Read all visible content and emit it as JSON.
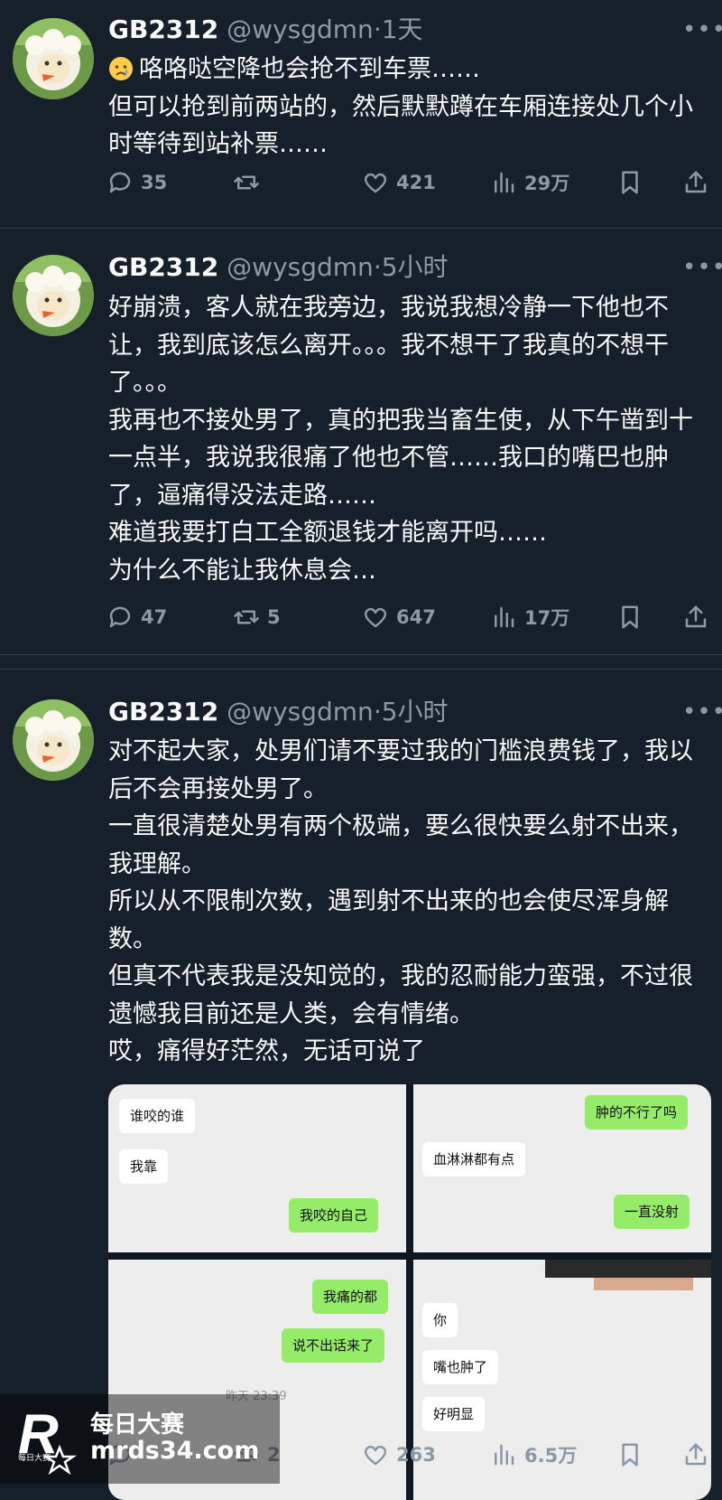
{
  "tweets": [
    {
      "name": "GB2312",
      "handle": "@wysgdmn",
      "dot": "·",
      "time": "1天",
      "emoji": "crying-face",
      "text": "咯咯哒空降也会抢不到车票……\n但可以抢到前两站的，然后默默蹲在车厢连接处几个小时等待到站补票……",
      "stats": {
        "replies": "35",
        "retweets": "",
        "likes": "421",
        "views": "29万"
      }
    },
    {
      "name": "GB2312",
      "handle": "@wysgdmn",
      "dot": "·",
      "time": "5小时",
      "text": "好崩溃，客人就在我旁边，我说我想冷静一下他也不让，我到底该怎么离开。。。我不想干了我真的不想干了。。。\n我再也不接处男了，真的把我当畜生使，从下午凿到十一点半，我说我很痛了他也不管……我口的嘴巴也肿了，逼痛得没法走路……\n难道我要打白工全额退钱才能离开吗……\n为什么不能让我休息会…",
      "stats": {
        "replies": "47",
        "retweets": "5",
        "likes": "647",
        "views": "17万"
      }
    },
    {
      "name": "GB2312",
      "handle": "@wysgdmn",
      "dot": "·",
      "time": "5小时",
      "text": "对不起大家，处男们请不要过我的门槛浪费钱了，我以后不会再接处男了。\n一直很清楚处男有两个极端，要么很快要么射不出来，我理解。\n所以从不限制次数，遇到射不出来的也会使尽浑身解数。\n但真不代表我是没知觉的，我的忍耐能力蛮强，不过很遗憾我目前还是人类，会有情绪。\n哎，痛得好茫然，无话可说了",
      "stats": {
        "replies": "",
        "retweets": "2",
        "likes": "263",
        "views": "6.5万"
      }
    }
  ],
  "chat_images": [
    {
      "bubbles": [
        {
          "side": "left",
          "text": "谁咬的谁"
        },
        {
          "side": "left",
          "text": "我靠"
        },
        {
          "side": "right",
          "text": "我咬的自己"
        }
      ]
    },
    {
      "bubbles": [
        {
          "side": "right",
          "text": "肿的不行了吗"
        },
        {
          "side": "left",
          "text": "血淋淋都有点"
        },
        {
          "side": "right",
          "text": "一直没射"
        }
      ]
    },
    {
      "bubbles": [
        {
          "side": "right",
          "text": "我痛的都"
        },
        {
          "side": "right",
          "text": "说不出话来了"
        }
      ],
      "timestamp": "昨天 23:39"
    },
    {
      "bubbles": [
        {
          "side": "left",
          "text": "你"
        },
        {
          "side": "left",
          "text": "嘴也肿了"
        },
        {
          "side": "left",
          "text": "好明显"
        }
      ]
    }
  ],
  "watermark": {
    "title": "每日大赛",
    "url": "mrds34.com",
    "mini": "每日大赛"
  },
  "colors": {
    "background": "#15202b",
    "text": "#f7f9f9",
    "secondary": "#8b98a5",
    "wechat_green": "#95ec69"
  }
}
